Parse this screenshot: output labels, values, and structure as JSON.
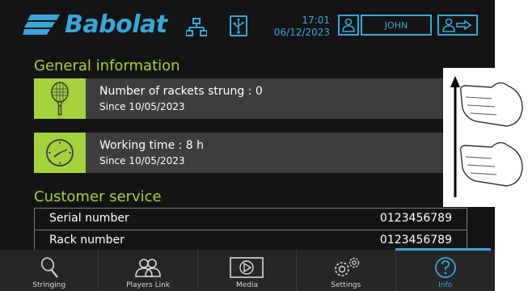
{
  "header": {
    "brand": "Babolat",
    "time": "17:01",
    "date": "06/12/2023",
    "user": "JOHN",
    "icons": [
      "network-icon",
      "usb-icon",
      "user-icon",
      "logout-icon"
    ]
  },
  "general": {
    "title": "General information",
    "rackets_title": "Number of rackets strung : 0",
    "rackets_since": "Since 10/05/2023",
    "working_title": "Working time : 8 h",
    "working_since": "Since 10/05/2023"
  },
  "customer_service": {
    "title": "Customer service",
    "rows": [
      {
        "label": "Serial number",
        "value": "0123456789"
      },
      {
        "label": "Rack number",
        "value": "0123456789"
      }
    ]
  },
  "nav": {
    "items": [
      {
        "label": "Stringing",
        "icon": "racket-icon"
      },
      {
        "label": "Players Link",
        "icon": "players-icon"
      },
      {
        "label": "Media",
        "icon": "media-play-icon"
      },
      {
        "label": "Settings",
        "icon": "gears-icon"
      },
      {
        "label": "Info",
        "icon": "question-icon"
      }
    ],
    "active": "Info"
  },
  "colors": {
    "accent_blue": "#3aa6d8",
    "accent_green": "#a4d13c",
    "background": "#141414",
    "card": "#3d3d3d"
  },
  "overlay": {
    "gesture": "scroll-up-hand-gesture"
  }
}
